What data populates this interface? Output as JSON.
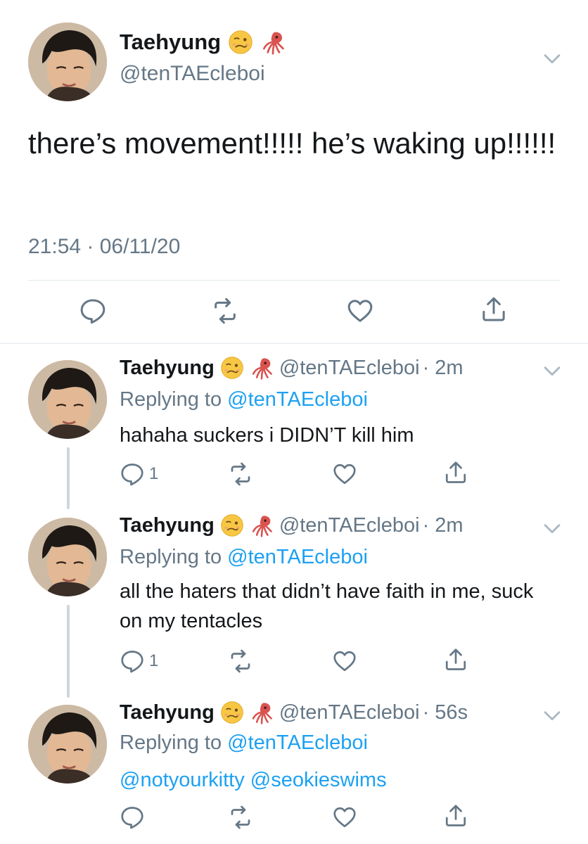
{
  "main_tweet": {
    "display_name": "Taehyung",
    "emojis": [
      "woozy-face-icon",
      "squid-icon"
    ],
    "handle": "@tenTAEcleboi",
    "text": "there’s movement!!!!! he’s waking up!!!!!!",
    "timestamp": "21:54 · 06/11/20"
  },
  "replies": [
    {
      "display_name": "Taehyung",
      "handle": "@tenTAEcleboi",
      "time": "· 2m",
      "replying_prefix": "Replying to ",
      "replying_to": "@tenTAEcleboi",
      "text": "hahaha suckers i DIDN’T kill him",
      "reply_count": "1"
    },
    {
      "display_name": "Taehyung",
      "handle": "@tenTAEcleboi",
      "time": "· 2m",
      "replying_prefix": "Replying to ",
      "replying_to": "@tenTAEcleboi",
      "text": "all the haters that didn’t have faith in me, suck on my tentacles",
      "reply_count": "1"
    },
    {
      "display_name": "Taehyung",
      "handle": "@tenTAEcleboi",
      "time": "· 56s",
      "replying_prefix": "Replying to ",
      "replying_to": "@tenTAEcleboi",
      "mentions": "@notyourkitty @seokieswims",
      "reply_count": ""
    }
  ],
  "colors": {
    "link": "#1da1f2",
    "secondary_text": "#657786",
    "primary_text": "#14171a",
    "divider": "#e1e8ed",
    "thread_line": "#ccd6dd"
  }
}
